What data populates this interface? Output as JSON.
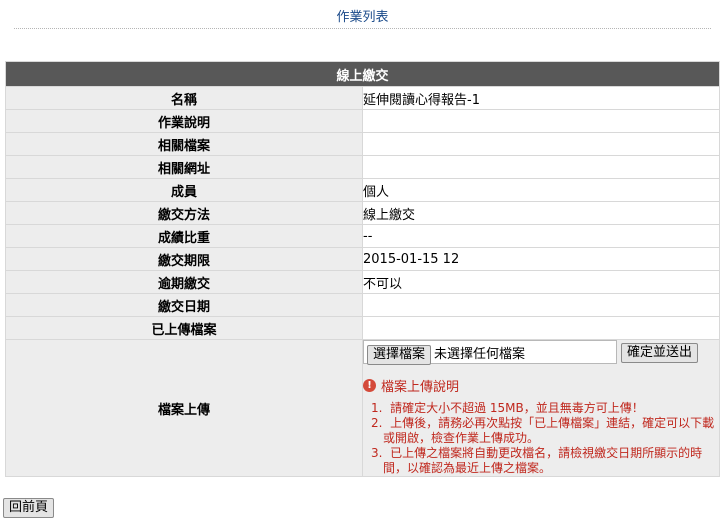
{
  "top_link": "作業列表",
  "panel_title": "線上繳交",
  "rows": [
    {
      "label": "名稱",
      "value": "延伸閱讀心得報告-1"
    },
    {
      "label": "作業說明",
      "value": ""
    },
    {
      "label": "相關檔案",
      "value": ""
    },
    {
      "label": "相關網址",
      "value": ""
    },
    {
      "label": "成員",
      "value": "個人"
    },
    {
      "label": "繳交方法",
      "value": "線上繳交"
    },
    {
      "label": "成績比重",
      "value": "--"
    },
    {
      "label": "繳交期限",
      "value": "2015-01-15 12"
    },
    {
      "label": "逾期繳交",
      "value": "不可以"
    },
    {
      "label": "繳交日期",
      "value": ""
    },
    {
      "label": "已上傳檔案",
      "value": ""
    }
  ],
  "upload": {
    "label": "檔案上傳",
    "choose_button": "選擇檔案",
    "file_status": "未選擇任何檔案",
    "submit_button": "確定並送出",
    "note_title": "檔案上傳說明",
    "notes": [
      "請確定大小不超過 15MB，並且無毒方可上傳！",
      "上傳後，請務必再次點按「已上傳檔案」連結，確定可以下載或開啟，檢查作業上傳成功。",
      "已上傳之檔案將自動更改檔名，請檢視繳交日期所顯示的時間，以確認為最近上傳之檔案。"
    ]
  },
  "back_button": "回前頁",
  "colors": {
    "header_bg": "#585858",
    "label_bg": "#ededed",
    "note_red": "#c0281e",
    "link_blue": "#1a4a8a"
  },
  "icons": {
    "note_icon": "warning-circle-icon"
  }
}
